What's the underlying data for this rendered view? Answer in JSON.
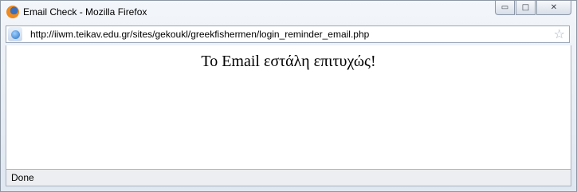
{
  "window": {
    "title": "Email Check - Mozilla Firefox",
    "controls": {
      "minimize": "▭",
      "maximize": "□",
      "close": "✕"
    }
  },
  "address_bar": {
    "url": "http://iiwm.teikav.edu.gr/sites/gekoukl/greekfishermen/login_reminder_email.php",
    "site_icon": "globe-icon",
    "bookmark_icon": "star-icon"
  },
  "page": {
    "message": "Το Email εστάλη επιτυχώς!"
  },
  "status_bar": {
    "text": "Done"
  }
}
